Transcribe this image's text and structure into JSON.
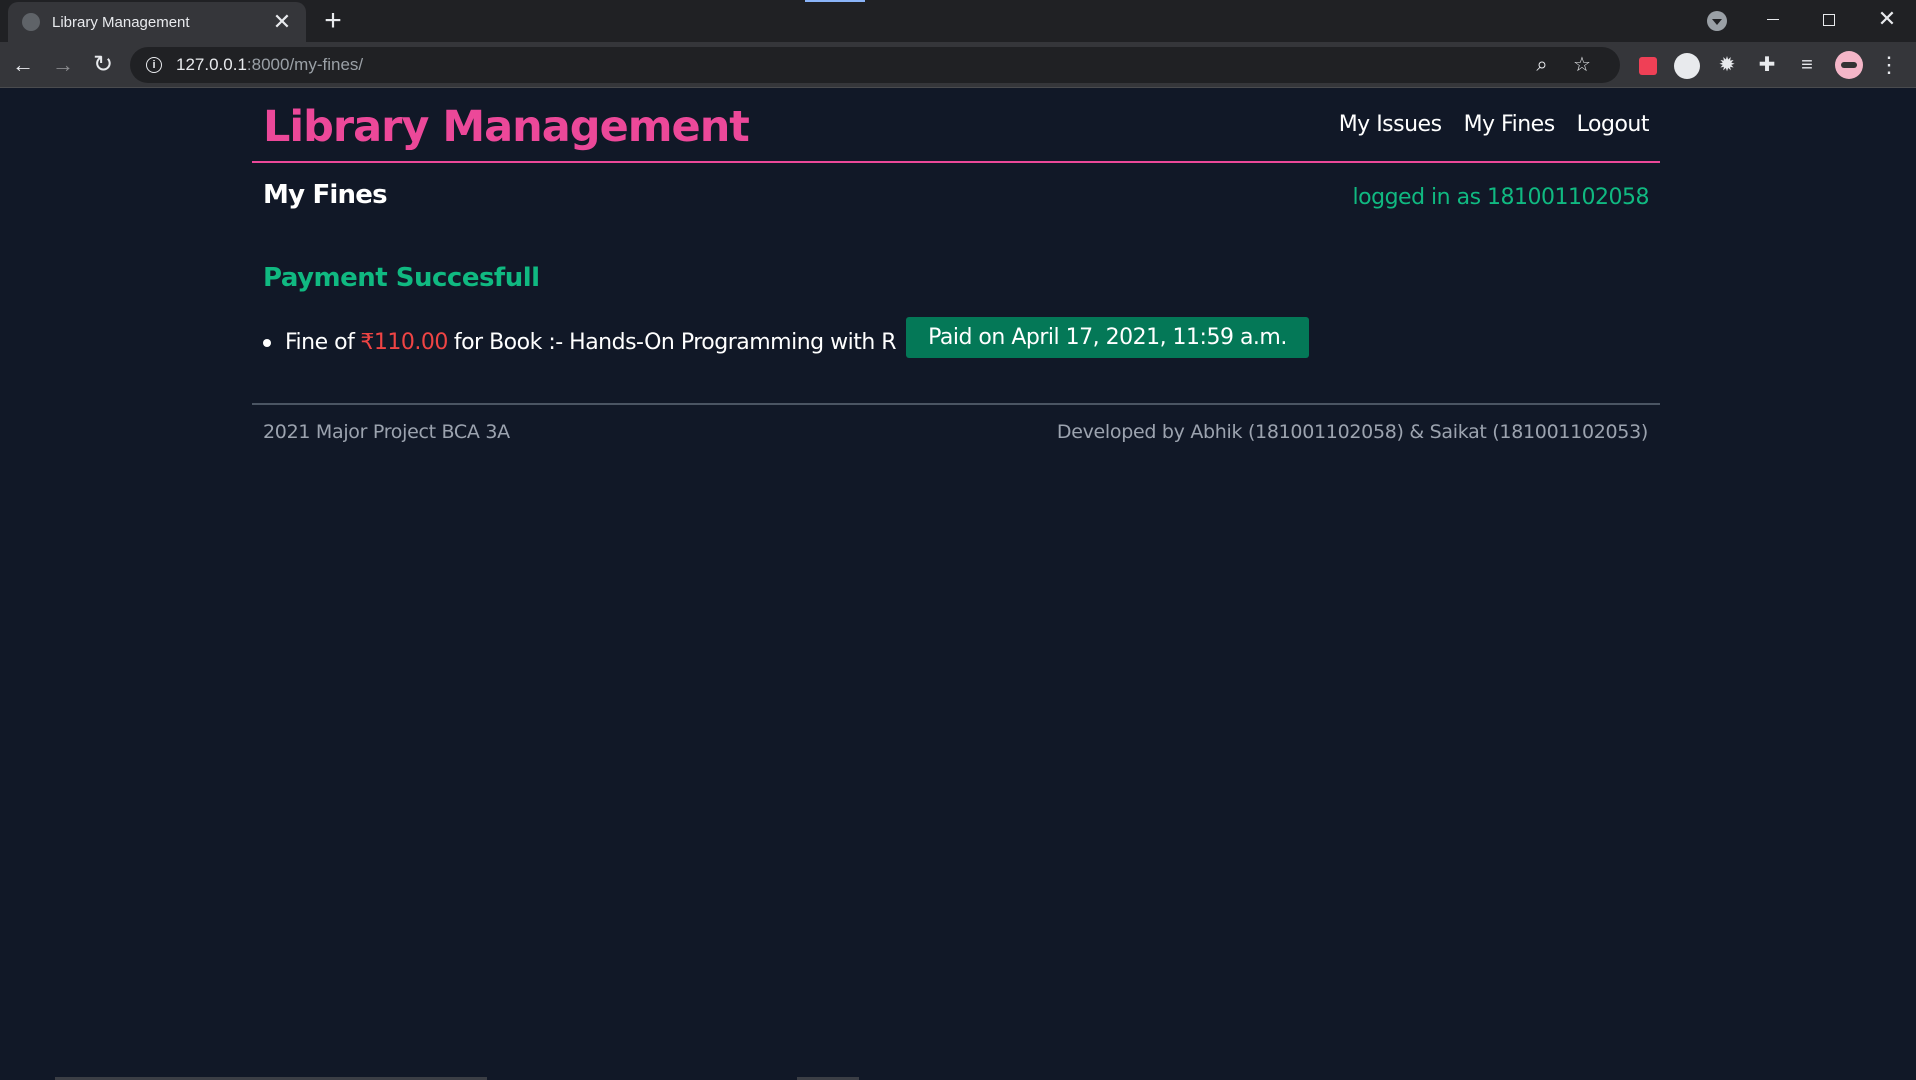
{
  "browser": {
    "tab_title": "Library Management",
    "tab_close": "✕",
    "new_tab": "+",
    "url_host": "127.0.0.1",
    "url_rest": ":8000/my-fines/"
  },
  "header": {
    "brand": "Library Management",
    "nav": [
      "My Issues",
      "My Fines",
      "Logout"
    ]
  },
  "page": {
    "title": "My Fines",
    "logged_in": "logged in as 181001102058",
    "payment_status": "Payment Succesfull"
  },
  "fines": [
    {
      "prefix": "Fine of",
      "amount": "₹110.00",
      "suffix": "for Book :- Hands-On Programming with R",
      "paid_label": "Paid on April 17, 2021, 11:59 a.m."
    }
  ],
  "footer": {
    "left": "2021 Major Project BCA 3A",
    "right": "Developed by Abhik (181001102058) & Saikat (181001102053)"
  },
  "colors": {
    "brand": "#ec4899",
    "success": "#10b981",
    "amount": "#ef4444",
    "badge": "#047857",
    "background": "#111827"
  },
  "icons": [
    "globe-icon",
    "close-icon",
    "plus-icon",
    "back-icon",
    "forward-icon",
    "reload-icon",
    "info-icon",
    "zoom-icon",
    "star-icon",
    "pocket-icon",
    "extension-circle-icon",
    "gear-icon",
    "puzzle-icon",
    "media-icon",
    "profile-avatar",
    "kebab-menu-icon"
  ]
}
